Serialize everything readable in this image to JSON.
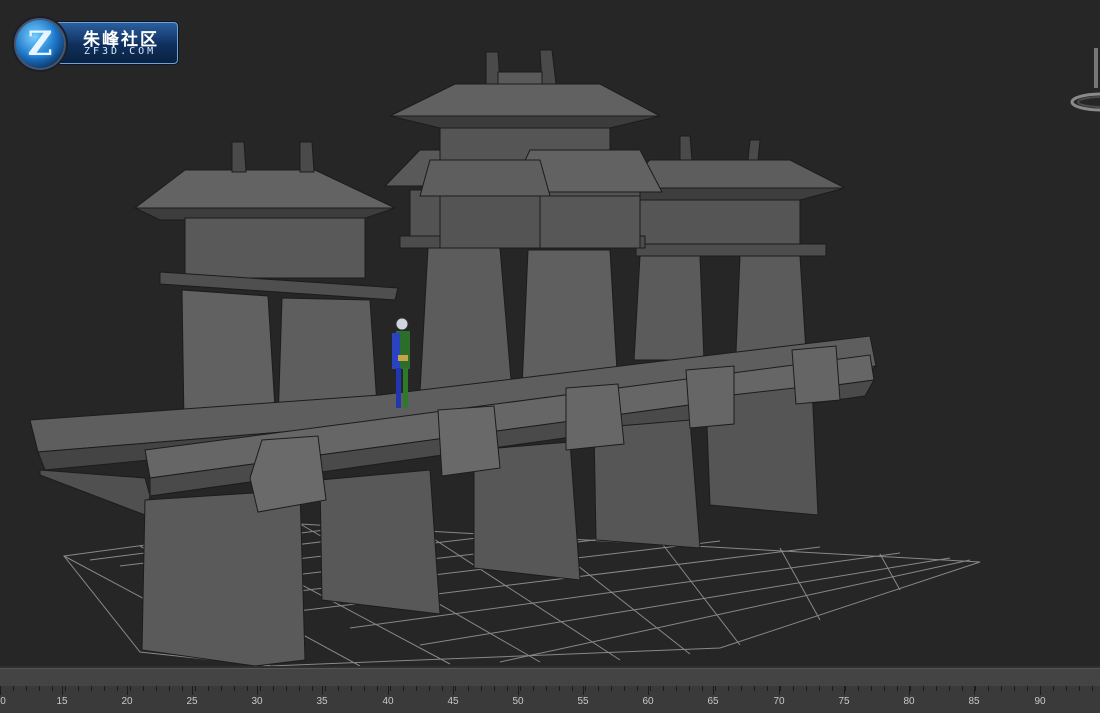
{
  "logo": {
    "cn_text": "朱峰社区",
    "en_text": "ZF3D.COM",
    "badge_letter": "Z"
  },
  "viewport": {
    "background": "#262626",
    "grid_color": "#9a9a9a",
    "model_color": "#5f5f5f"
  },
  "timeline": {
    "labels": [
      "0",
      "15",
      "20",
      "25",
      "30",
      "35",
      "40",
      "45",
      "50",
      "55",
      "60",
      "65",
      "70",
      "75",
      "80",
      "85",
      "90"
    ]
  }
}
